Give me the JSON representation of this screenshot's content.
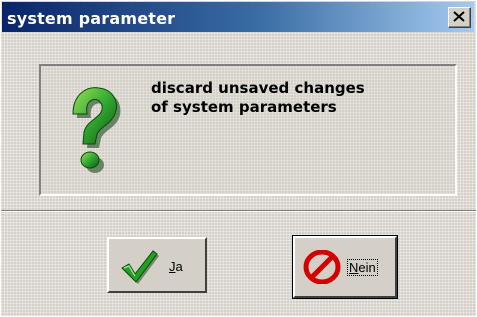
{
  "window": {
    "title": "system parameter",
    "close_icon": "close-icon"
  },
  "message": {
    "icon": "question-icon",
    "line1": "discard unsaved changes",
    "line2": "of system parameters"
  },
  "buttons": {
    "yes": {
      "label_mnemonic": "J",
      "label_rest": "a",
      "icon": "checkmark-icon"
    },
    "no": {
      "label_mnemonic": "N",
      "label_rest": "ein",
      "icon": "no-entry-icon",
      "focused": true
    }
  },
  "colors": {
    "title_start": "#0a246a",
    "title_end": "#a6caf0",
    "face": "#d4d0c8",
    "question_green": "#2e9a2e",
    "check_green": "#1e8f1e",
    "stop_red": "#d40000"
  }
}
